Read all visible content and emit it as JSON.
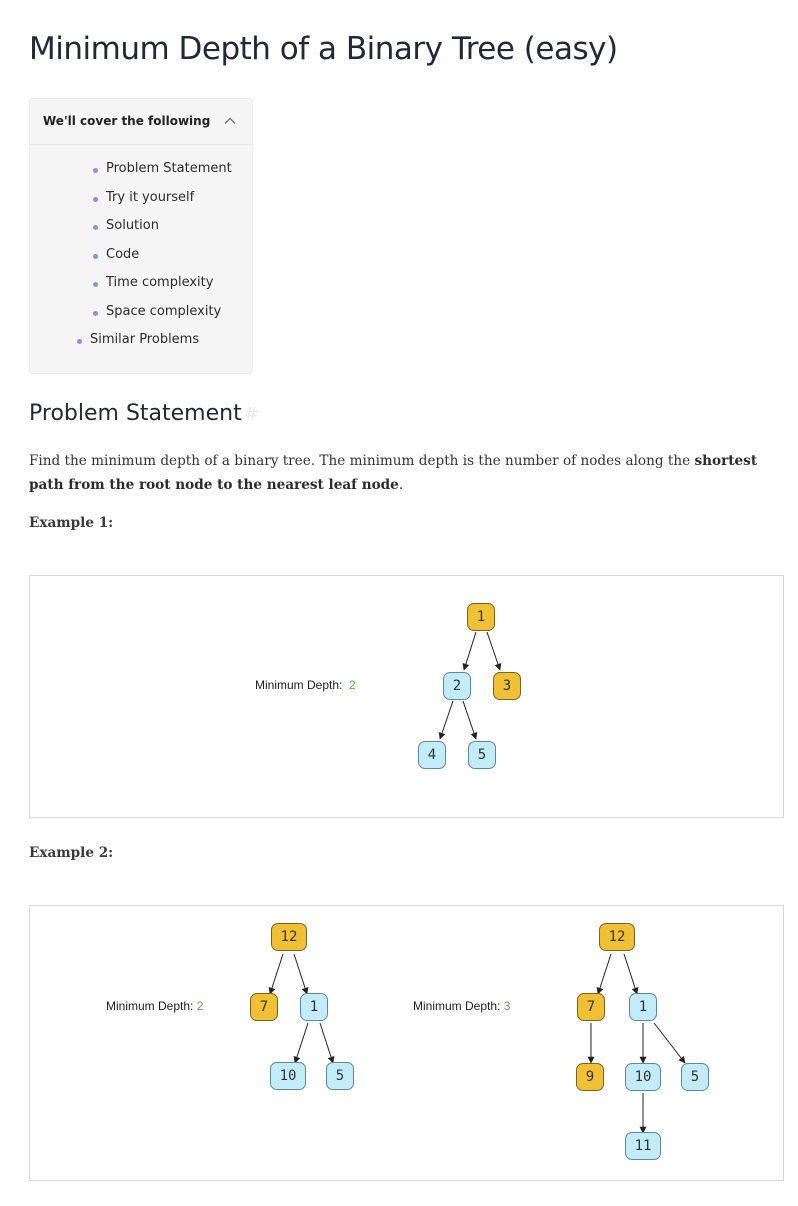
{
  "title": "Minimum Depth of a Binary Tree (easy)",
  "toc": {
    "header": "We'll cover the following",
    "items": [
      "Problem Statement",
      "Try it yourself",
      "Solution",
      "Code",
      "Time complexity",
      "Space complexity",
      "Similar Problems"
    ]
  },
  "section": {
    "title": "Problem Statement",
    "anchor": "#",
    "paragraph_start": "Find the minimum depth of a binary tree. The minimum depth is the number of nodes along the ",
    "paragraph_bold": "shortest path from the root node to the nearest leaf node",
    "paragraph_end": "."
  },
  "example1": {
    "label": "Example 1:",
    "md_label": "Minimum Depth:",
    "md_value": "2",
    "nodes": [
      "1",
      "2",
      "3",
      "4",
      "5"
    ]
  },
  "example2": {
    "label": "Example 2:",
    "left": {
      "md_label": "Minimum Depth:",
      "md_value": "2",
      "nodes": [
        "12",
        "7",
        "1",
        "10",
        "5"
      ]
    },
    "right": {
      "md_label": "Minimum Depth:",
      "md_value": "3",
      "nodes": [
        "12",
        "7",
        "1",
        "9",
        "10",
        "5",
        "11"
      ]
    }
  },
  "colors": {
    "highlight_node": "#f0c135",
    "normal_node": "#c4ecf8",
    "bullet": "#8a8ef0",
    "md_value": "#5aa848"
  }
}
